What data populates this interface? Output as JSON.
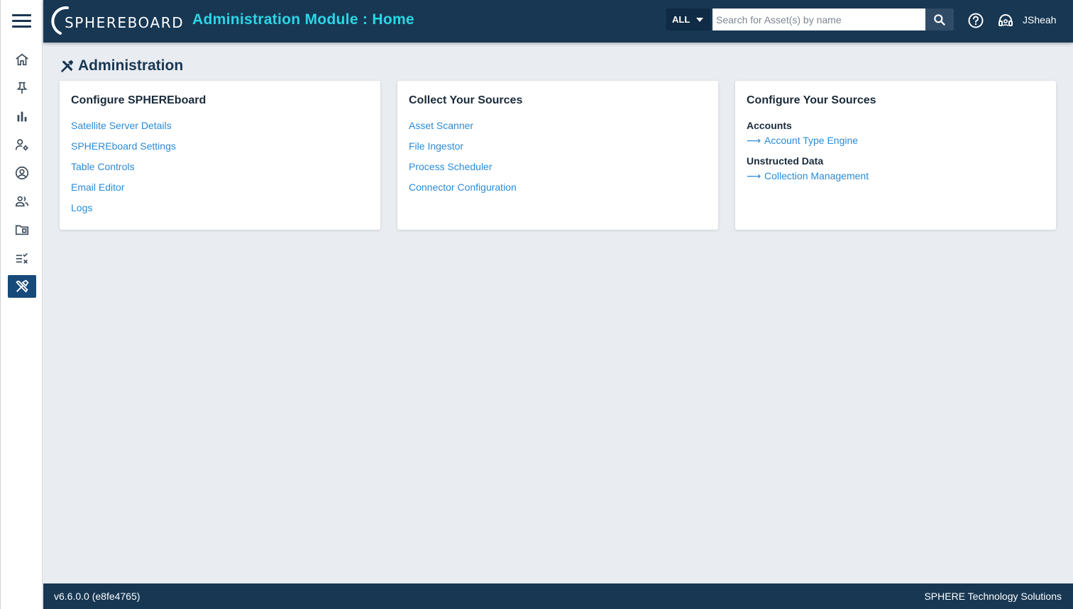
{
  "header": {
    "logo_text": "SPHEREBOARD",
    "module_title": "Administration Module : Home",
    "scope_value": "ALL",
    "search_placeholder": "Search for Asset(s) by name",
    "username": "JSheah"
  },
  "rail": {
    "items": [
      "home-icon",
      "pin-icon",
      "chart-icon",
      "user-settings-icon",
      "account-icon",
      "people-icon",
      "folder-icon",
      "checklist-icon",
      "tools-icon"
    ],
    "active": "tools-icon"
  },
  "page": {
    "title": "Administration"
  },
  "cards": {
    "configure": {
      "title": "Configure SPHEREboard",
      "links": [
        "Satellite Server Details",
        "SPHEREboard Settings",
        "Table Controls",
        "Email Editor",
        "Logs"
      ]
    },
    "collect": {
      "title": "Collect Your Sources",
      "links": [
        "Asset Scanner",
        "File Ingestor",
        "Process Scheduler",
        "Connector Configuration"
      ]
    },
    "sources": {
      "title": "Configure Your Sources",
      "sections": [
        {
          "label": "Accounts",
          "link": "Account Type Engine"
        },
        {
          "label": "Unstructed Data",
          "link": "Collection Management"
        }
      ]
    }
  },
  "footer": {
    "version": "v6.6.0.0 (e8fe4765)",
    "company": "SPHERE Technology Solutions"
  },
  "colors": {
    "header_bg": "#173753",
    "accent": "#2bd6e6",
    "link": "#2a8bd8",
    "active_nav": "#164a7a"
  }
}
